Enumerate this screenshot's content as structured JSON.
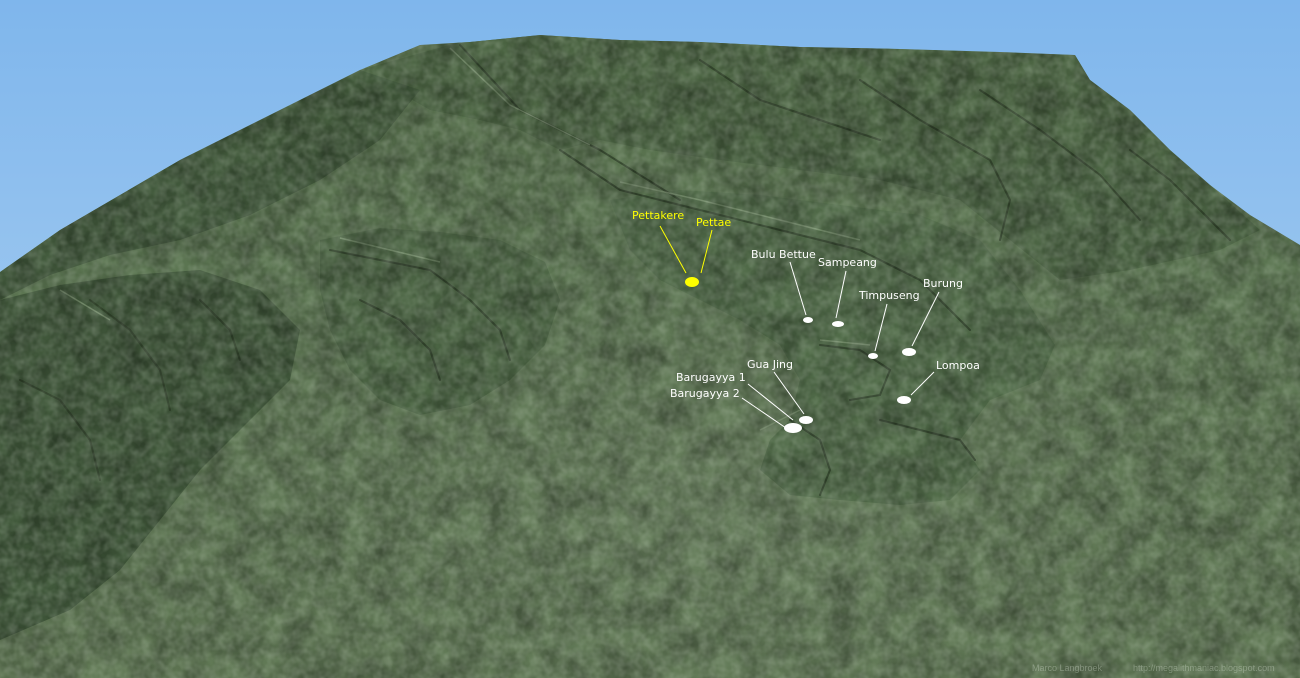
{
  "map": {
    "sites_yellow": [
      {
        "key": "pettakere",
        "label": "Pettakere"
      },
      {
        "key": "pettae",
        "label": "Pettae"
      }
    ],
    "sites_white": [
      {
        "key": "bulu_bettue",
        "label": "Bulu Bettue"
      },
      {
        "key": "sampeang",
        "label": "Sampeang"
      },
      {
        "key": "timpuseng",
        "label": "Timpuseng"
      },
      {
        "key": "burung",
        "label": "Burung"
      },
      {
        "key": "lompoa",
        "label": "Lompoa"
      },
      {
        "key": "gua_jing",
        "label": "Gua Jing"
      },
      {
        "key": "barugayya_1",
        "label": "Barugayya 1"
      },
      {
        "key": "barugayya_2",
        "label": "Barugayya 2"
      }
    ],
    "credit_author": "Marco Langbroek",
    "credit_url": "http://megalithmaniac.blogspot.com",
    "colors": {
      "sky_top": "#7fb6ec",
      "sky_bottom": "#b7d7f3",
      "terrain": "#5c7a52",
      "ridge_dark": "#2f4228",
      "ridge_light": "#8ea883",
      "highlight_label": "#ffff00",
      "site_label": "#ffffff"
    }
  }
}
